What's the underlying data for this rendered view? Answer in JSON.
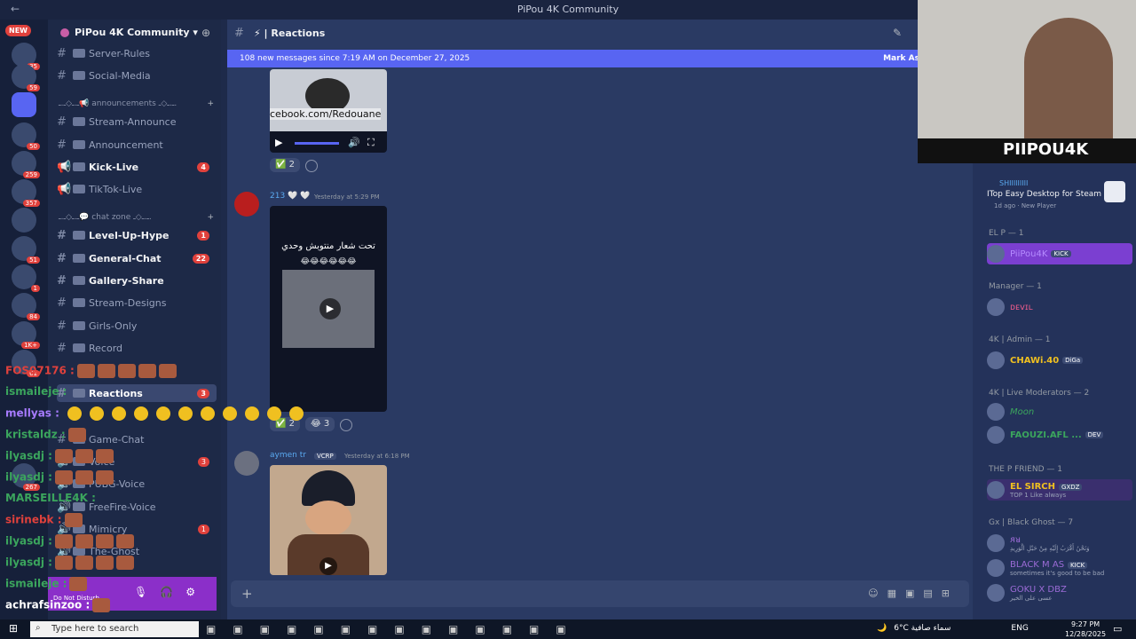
{
  "window": {
    "title": "PiPou 4K Community",
    "back": "←"
  },
  "guilds": {
    "new_label": "NEW",
    "badges": [
      "35",
      "59",
      "50",
      "259",
      "357",
      "51",
      "1",
      "84",
      "1K+",
      "61",
      "267"
    ]
  },
  "server": {
    "name": "PiPou 4K Community",
    "chevron": "▾"
  },
  "channels": [
    {
      "name": "Server-Rules",
      "hash": "#"
    },
    {
      "name": "Social-Media",
      "hash": "#"
    },
    {
      "category": "ـ.ـ◇ـ.ـ📢 announcements ـ.ـ◇ـ."
    },
    {
      "name": "Stream-Announce",
      "hash": "#"
    },
    {
      "name": "Announcement",
      "hash": "#"
    },
    {
      "name": "Kick-Live",
      "hash": "📢",
      "bold": true,
      "count": "4"
    },
    {
      "name": "TikTok-Live",
      "hash": "📢"
    },
    {
      "category": "ـ.ـ◇ـ.ـ💬 chat zone ـ.ـ◇ـ."
    },
    {
      "name": "Level-Up-Hype",
      "hash": "#",
      "bold": true,
      "count": "1"
    },
    {
      "name": "General-Chat",
      "hash": "#",
      "bold": true,
      "count": "22"
    },
    {
      "name": "Gallery-Share",
      "hash": "#",
      "bold": true
    },
    {
      "name": "Stream-Designs",
      "hash": "#"
    },
    {
      "name": "Girls-Only",
      "hash": "#"
    },
    {
      "name": "Record",
      "hash": "#"
    },
    {
      "name": "Reactions",
      "hash": "#",
      "active": true,
      "count": "3"
    },
    {
      "name": "Game-Chat",
      "hash": "#"
    },
    {
      "name": "Voice",
      "hash": "🔊",
      "count": "3"
    },
    {
      "name": "PUBG-Voice",
      "hash": "🔊"
    },
    {
      "name": "FreeFire-Voice",
      "hash": "🔊"
    },
    {
      "name": "Mimicry",
      "hash": "🔊",
      "count": "1"
    },
    {
      "name": "The-Ghost",
      "hash": "🔊"
    }
  ],
  "userbar": {
    "status": "Do Not Disturb"
  },
  "channel_header": {
    "name": "Reactions",
    "hash": "#"
  },
  "new_messages": {
    "text": "108 new messages since 7:19 AM on December 27, 2025",
    "action": "Mark As"
  },
  "messages": [
    {
      "video_caption": "cebook.com/Redouane",
      "reactions": [
        {
          "emoji": "✅",
          "count": "2"
        }
      ]
    },
    {
      "author": "213 🤍 🤍",
      "time": "Yesterday at 5:29 PM",
      "video_caption": "تحت شعار منتوبش وحدي",
      "reactions": [
        {
          "emoji": "✅",
          "count": "2"
        },
        {
          "emoji": "😂",
          "count": "3"
        }
      ]
    },
    {
      "author": "aymen tr",
      "tag": "VCRP",
      "time": "Yesterday at 6:18 PM"
    }
  ],
  "composer": {
    "plus": "+"
  },
  "activity": {
    "name": "SHIIIIIIIII",
    "game": "ITop Easy Desktop for Steam",
    "meta": "1d ago · New Player"
  },
  "members": [
    {
      "group": "EL P — 1"
    },
    {
      "name": "PiiPou4K",
      "tag": "KICK",
      "color": "#b58cff"
    },
    {
      "group": "Manager — 1"
    },
    {
      "name": "ᴅᴇᴠɪʟ",
      "color": "#e85a8a"
    },
    {
      "group": "4K | Admin — 1"
    },
    {
      "name": "CHAWi.40",
      "tag": "DiGa",
      "color": "#f0c020"
    },
    {
      "group": "4K | Live Moderators — 2"
    },
    {
      "name": "Moon",
      "color": "#3ba55d"
    },
    {
      "name": "FAOUZI.AFL ...",
      "tag": "DEV",
      "color": "#3ba55d"
    },
    {
      "group": "THE P FRIEND — 1"
    },
    {
      "name": "EL SIRCH",
      "tag": "GXDZ",
      "sub": "TOP 1 Like always",
      "color": "#f0c020"
    },
    {
      "group": "Gx | Black Ghost — 7"
    },
    {
      "name": "ᴙᴚ",
      "sub": "وَنَحْنُ أَقْرَبُ إِلَيْهِ مِنْ حَبْلِ الْوَرِيدِ",
      "color": "#9b6bd6"
    },
    {
      "name": "BLACK M AS",
      "tag": "KICK",
      "sub": "sometimes it's good to be bad",
      "color": "#9b6bd6"
    },
    {
      "name": "GOKU X DBZ",
      "sub": "عسى على الخير",
      "color": "#9b6bd6"
    }
  ],
  "webcam": {
    "logo": "PIIPOU4K"
  },
  "overlay_chat": [
    {
      "user": "FOS07176",
      "suffix": ":",
      "color": "#e0413c",
      "emotes": 5
    },
    {
      "user": "ismaileje",
      "suffix": ":",
      "color": "#3ba55d",
      "emotes": 0
    },
    {
      "user": "mellyas",
      "suffix": ":",
      "color": "#a77bff",
      "smileys": 11
    },
    {
      "user": "kristaldz",
      "suffix": ":",
      "color": "#3ba55d",
      "emotes": 1
    },
    {
      "user": "ilyasdj",
      "suffix": ":",
      "color": "#3ba55d",
      "emotes": 3
    },
    {
      "user": "ilyasdj",
      "suffix": ":",
      "color": "#3ba55d",
      "emotes": 3
    },
    {
      "user": "MARSEILLE4K",
      "suffix": ":",
      "color": "#3ba55d",
      "emotes": 0
    },
    {
      "user": "sirinebk",
      "suffix": ":",
      "color": "#e0413c",
      "emotes": 1
    },
    {
      "user": "ilyasdj",
      "suffix": ":",
      "color": "#3ba55d",
      "emotes": 4
    },
    {
      "user": "ilyasdj",
      "suffix": ":",
      "color": "#3ba55d",
      "emotes": 4
    },
    {
      "user": "ismaileje",
      "suffix": ":",
      "color": "#3ba55d",
      "emotes": 1
    },
    {
      "user": "achrafsinzoo",
      "suffix": ":",
      "color": "#ffffff",
      "emotes": 1
    }
  ],
  "taskbar": {
    "search_placeholder": "Type here to search",
    "weather": "6°C سماء صافية",
    "lang": "ENG",
    "time": "9:27 PM",
    "date": "12/28/2025"
  }
}
